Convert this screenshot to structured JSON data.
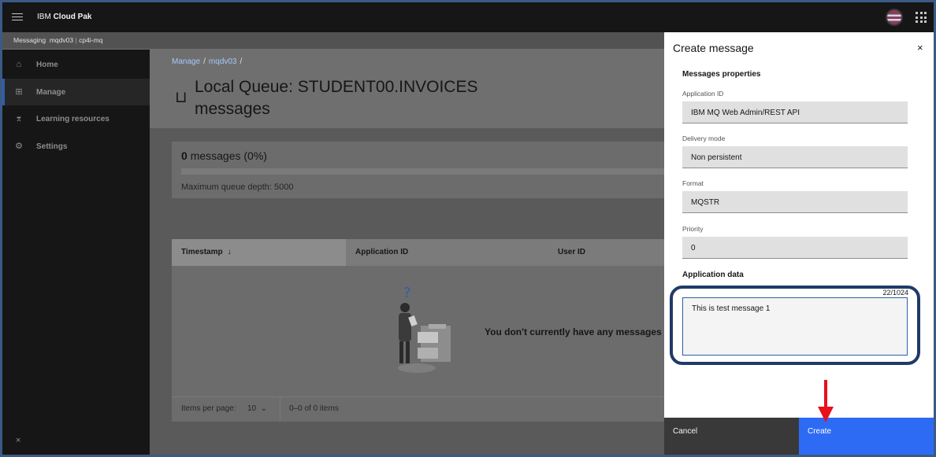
{
  "header": {
    "brand_prefix": "IBM",
    "brand_name": "Cloud Pak"
  },
  "subheader": {
    "app": "Messaging",
    "instance": "mqdv03",
    "separator": "|",
    "namespace": "cp4i-mq"
  },
  "sidebar": {
    "items": [
      {
        "label": "Home",
        "icon": "home-icon"
      },
      {
        "label": "Manage",
        "icon": "grid-icon"
      },
      {
        "label": "Learning resources",
        "icon": "learning-icon"
      },
      {
        "label": "Settings",
        "icon": "gear-icon"
      }
    ],
    "active_index": 1,
    "close_label": "×"
  },
  "main": {
    "breadcrumb": [
      "Manage",
      "mqdv03"
    ],
    "breadcrumb_sep": "/",
    "title_line1": "Local Queue: STUDENT00.INVOICES",
    "title_line2": "messages",
    "stats": {
      "count": "0",
      "count_suffix": "messages (0%)",
      "progress_fraction": 0.0,
      "max_depth": "Maximum queue depth: 5000"
    },
    "table": {
      "columns": [
        "Timestamp",
        "Application ID",
        "User ID"
      ],
      "sort_icon": "arrow-down-icon",
      "empty_message": "You don't currently have any messages to display"
    },
    "pager": {
      "items_per_page_label": "Items per page:",
      "items_per_page_value": "10",
      "range": "0–0 of 0 items"
    }
  },
  "panel": {
    "title": "Create message",
    "close_label": "×",
    "section_properties": "Messages properties",
    "fields": [
      {
        "label": "Application ID",
        "value": "IBM MQ Web Admin/REST API"
      },
      {
        "label": "Delivery mode",
        "value": "Non persistent"
      },
      {
        "label": "Format",
        "value": "MQSTR"
      },
      {
        "label": "Priority",
        "value": "0"
      }
    ],
    "section_data": "Application data",
    "char_count": "22/1024",
    "application_data": "This is test message 1",
    "cancel_label": "Cancel",
    "create_label": "Create"
  },
  "colors": {
    "accent": "#2d6bf5",
    "annotation_ring": "#1f3a66",
    "annotation_arrow": "#e8101a"
  }
}
